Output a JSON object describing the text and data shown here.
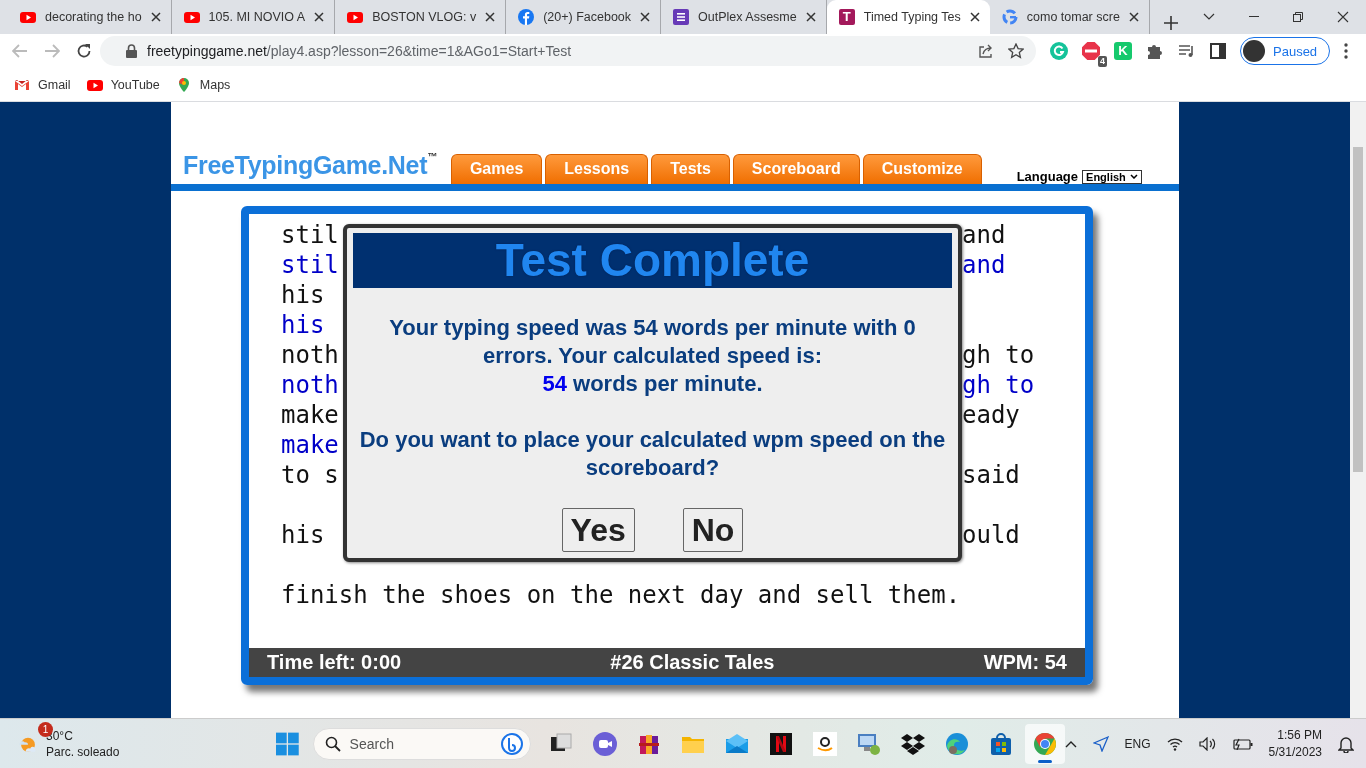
{
  "browser": {
    "tabs": [
      {
        "kind": "video",
        "title": "decorating the ho",
        "selected": false
      },
      {
        "kind": "video",
        "title": "105. MI NOVIO A",
        "selected": false
      },
      {
        "kind": "video",
        "title": "BOSTON VLOG: v",
        "selected": false
      },
      {
        "kind": "social",
        "title": "(20+) Facebook",
        "selected": false
      },
      {
        "kind": "form",
        "title": "OutPlex Assesme",
        "selected": false
      },
      {
        "kind": "letter",
        "letter": "T",
        "title": "Timed Typing Tes",
        "selected": true
      },
      {
        "kind": "search",
        "title": "como tomar scre",
        "selected": false
      }
    ],
    "address": {
      "domain": "freetypinggame.net",
      "path": "/play4.asp?lesson=26&time=1&AGo1=Start+Test"
    },
    "extensions": [
      {
        "kind": "grammar"
      },
      {
        "kind": "blocker",
        "badge": "4"
      },
      {
        "kind": "letter",
        "letter": "K"
      },
      {
        "kind": "puzzle"
      },
      {
        "kind": "media"
      },
      {
        "kind": "panel"
      }
    ],
    "profile": {
      "status": "Paused"
    },
    "bookmarks": [
      {
        "kind": "mail",
        "label": "Gmail"
      },
      {
        "kind": "video",
        "label": "YouTube"
      },
      {
        "kind": "pin",
        "label": "Maps"
      }
    ]
  },
  "site": {
    "logo": "FreeTypingGame.Net",
    "logo_mark": "™",
    "nav": [
      {
        "label": "Games"
      },
      {
        "label": "Lessons"
      },
      {
        "label": "Tests"
      },
      {
        "label": "Scoreboard"
      },
      {
        "label": "Customize"
      }
    ],
    "language": {
      "label": "Language",
      "value": "English"
    }
  },
  "typing": {
    "rows": [
      {
        "kind": "original",
        "left": "stil",
        "right": "and"
      },
      {
        "kind": "typed",
        "left": "stil",
        "right": "and"
      },
      {
        "kind": "original",
        "left": "his"
      },
      {
        "kind": "typed",
        "left": "his"
      },
      {
        "kind": "original",
        "left": "noth",
        "right": "gh to"
      },
      {
        "kind": "typed",
        "left": "noth",
        "right": "gh to"
      },
      {
        "kind": "original",
        "left": "make",
        "right": "eady"
      },
      {
        "kind": "typed",
        "left": "make"
      },
      {
        "kind": "original",
        "left": "to s",
        "right": "said"
      },
      {
        "kind": "blank"
      },
      {
        "kind": "original",
        "left": "his",
        "right": "ould"
      },
      {
        "kind": "blank"
      },
      {
        "kind": "original",
        "left": "finish the shoes on the next day and sell them."
      }
    ],
    "status": {
      "time_left": "Time left: 0:00",
      "lesson": "#26 Classic Tales",
      "wpm": "WPM: 54"
    }
  },
  "dialog": {
    "title": "Test Complete",
    "message": "Your typing speed was 54 words per minute with 0 errors. Your calculated speed is:",
    "speed": "54",
    "speed_unit": "words per minute.",
    "question": "Do you want to place your calculated wpm speed on the scoreboard?",
    "buttons": [
      "Yes",
      "No"
    ]
  },
  "taskbar": {
    "weather": {
      "badge": "1",
      "temperature": "30°C",
      "condition": "Parc. soleado"
    },
    "search": {
      "placeholder": "Search"
    },
    "apps": [
      {
        "kind": "taskview",
        "selected": false
      },
      {
        "kind": "meet",
        "selected": false
      },
      {
        "kind": "archive",
        "selected": false
      },
      {
        "kind": "folder",
        "selected": false
      },
      {
        "kind": "mail",
        "selected": false
      },
      {
        "kind": "movies",
        "selected": false
      },
      {
        "kind": "shop",
        "selected": false
      },
      {
        "kind": "remote",
        "selected": false
      },
      {
        "kind": "dropbox",
        "selected": false
      },
      {
        "kind": "edge",
        "selected": false
      },
      {
        "kind": "store",
        "selected": false
      },
      {
        "kind": "chrome",
        "selected": true
      }
    ],
    "language": "ENG",
    "time": "1:56 PM",
    "date": "5/31/2023"
  }
}
